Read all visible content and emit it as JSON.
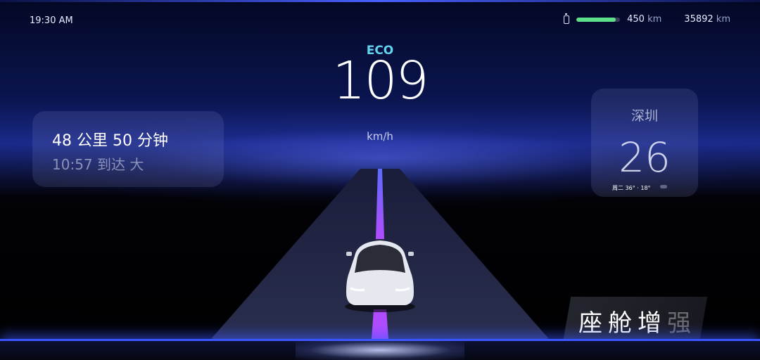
{
  "status": {
    "time": "19:30 AM",
    "battery_level_fraction": 0.9,
    "range_value": "450",
    "range_unit": "km",
    "odometer_value": "35892",
    "odometer_unit": "km",
    "battery_color": "#5ee08a"
  },
  "speedometer": {
    "drive_mode": "ECO",
    "speed": "109",
    "unit": "km/h"
  },
  "navigation": {
    "distance_time": "48 公里  50 分钟",
    "arrival": "10:57 到达 大"
  },
  "weather": {
    "city": "深圳",
    "temperature": "26",
    "forecast": "周二 36° · 18°",
    "icon": "cloud-icon"
  },
  "branding": {
    "text_main": "座舱增",
    "text_faded": "强"
  },
  "colors": {
    "accent_blue": "#3a55ff",
    "eco_cyan": "#63d3f0",
    "lane_purple": "#a04cff"
  }
}
